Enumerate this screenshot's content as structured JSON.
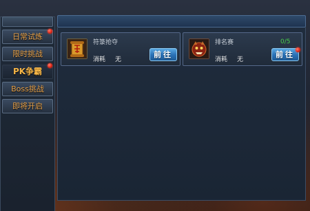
{
  "sidebar": {
    "items": [
      {
        "label": "日常试炼",
        "badge": true
      },
      {
        "label": "限时挑战",
        "badge": false
      },
      {
        "label": "PK争霸",
        "badge": true,
        "active": true
      },
      {
        "label": "Boss挑战",
        "badge": false
      },
      {
        "label": "即将开启",
        "badge": false
      }
    ]
  },
  "cards": [
    {
      "title": "符箓抢夺",
      "cost_label": "消耗",
      "cost_value": "无",
      "button_label": "前往",
      "icon": "scroll-icon"
    },
    {
      "title": "排名赛",
      "cost_label": "消耗",
      "cost_value": "无",
      "progress": "0/5",
      "button_label": "前往",
      "icon": "demon-mask-icon",
      "badge": true
    }
  ],
  "colors": {
    "menu_text": "#e8a24a",
    "button_blue": "#2c73b8",
    "progress_green": "#49d14a",
    "badge_red": "#e02a1a"
  }
}
